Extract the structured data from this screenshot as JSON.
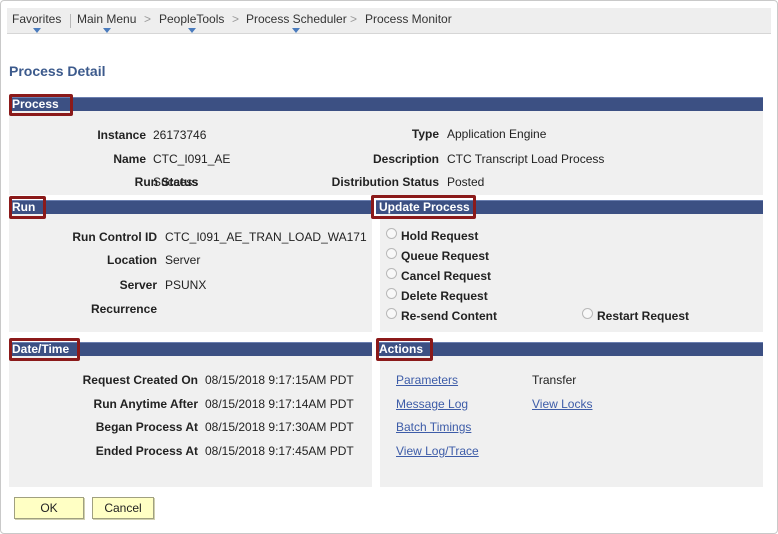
{
  "nav": {
    "favorites": "Favorites",
    "main_menu": "Main Menu",
    "peopletools": "PeopleTools",
    "process_scheduler": "Process Scheduler",
    "process_monitor": "Process Monitor",
    "separator": ">"
  },
  "page_title": "Process Detail",
  "process": {
    "header": "Process",
    "instance_label": "Instance",
    "instance_value": "26173746",
    "name_label": "Name",
    "name_value": "CTC_I091_AE",
    "run_status_label": "Run Status",
    "run_status_value": "Success",
    "type_label": "Type",
    "type_value": "Application Engine",
    "description_label": "Description",
    "description_value": "CTC Transcript Load Process",
    "dist_status_label": "Distribution Status",
    "dist_status_value": "Posted"
  },
  "run": {
    "header": "Run",
    "run_control_label": "Run Control ID",
    "run_control_value": "CTC_I091_AE_TRAN_LOAD_WA171",
    "location_label": "Location",
    "location_value": "Server",
    "server_label": "Server",
    "server_value": "PSUNX",
    "recurrence_label": "Recurrence",
    "recurrence_value": ""
  },
  "update_process": {
    "header": "Update Process",
    "options": [
      "Hold Request",
      "Queue Request",
      "Cancel Request",
      "Delete Request",
      "Re-send Content",
      "Restart Request"
    ]
  },
  "datetime": {
    "header": "Date/Time",
    "created_label": "Request Created On",
    "created_value": "08/15/2018  9:17:15AM PDT",
    "anytime_label": "Run Anytime After",
    "anytime_value": "08/15/2018  9:17:14AM PDT",
    "began_label": "Began Process At",
    "began_value": "08/15/2018  9:17:30AM PDT",
    "ended_label": "Ended Process At",
    "ended_value": "08/15/2018  9:17:45AM PDT"
  },
  "actions": {
    "header": "Actions",
    "parameters": "Parameters",
    "transfer": "Transfer",
    "message_log": "Message Log",
    "view_locks": "View Locks",
    "batch_timings": "Batch Timings",
    "view_log_trace": "View Log/Trace"
  },
  "buttons": {
    "ok": "OK",
    "cancel": "Cancel"
  },
  "colors": {
    "section_bar": "#3c5083",
    "highlight_box": "#8b1a1a",
    "link": "#3d5ca8",
    "button_bg": "#ffffc4",
    "title": "#3c5a8c"
  }
}
